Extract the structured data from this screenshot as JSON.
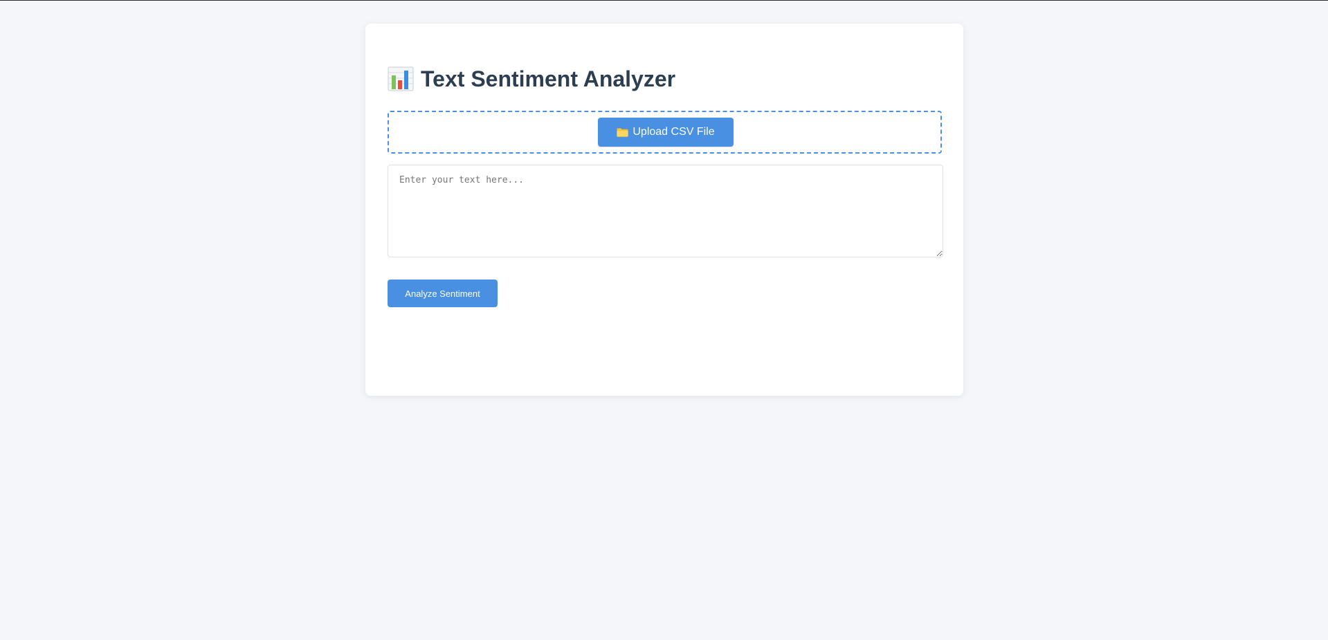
{
  "header": {
    "title": "Text Sentiment Analyzer",
    "icon": "bar-chart-icon"
  },
  "upload": {
    "button_label": "Upload CSV File",
    "icon": "folder-icon"
  },
  "text_input": {
    "placeholder": "Enter your text here...",
    "value": ""
  },
  "actions": {
    "analyze_label": "Analyze Sentiment"
  },
  "colors": {
    "accent": "#4a90e2",
    "title": "#2c3e50",
    "background": "#f4f6f9"
  }
}
